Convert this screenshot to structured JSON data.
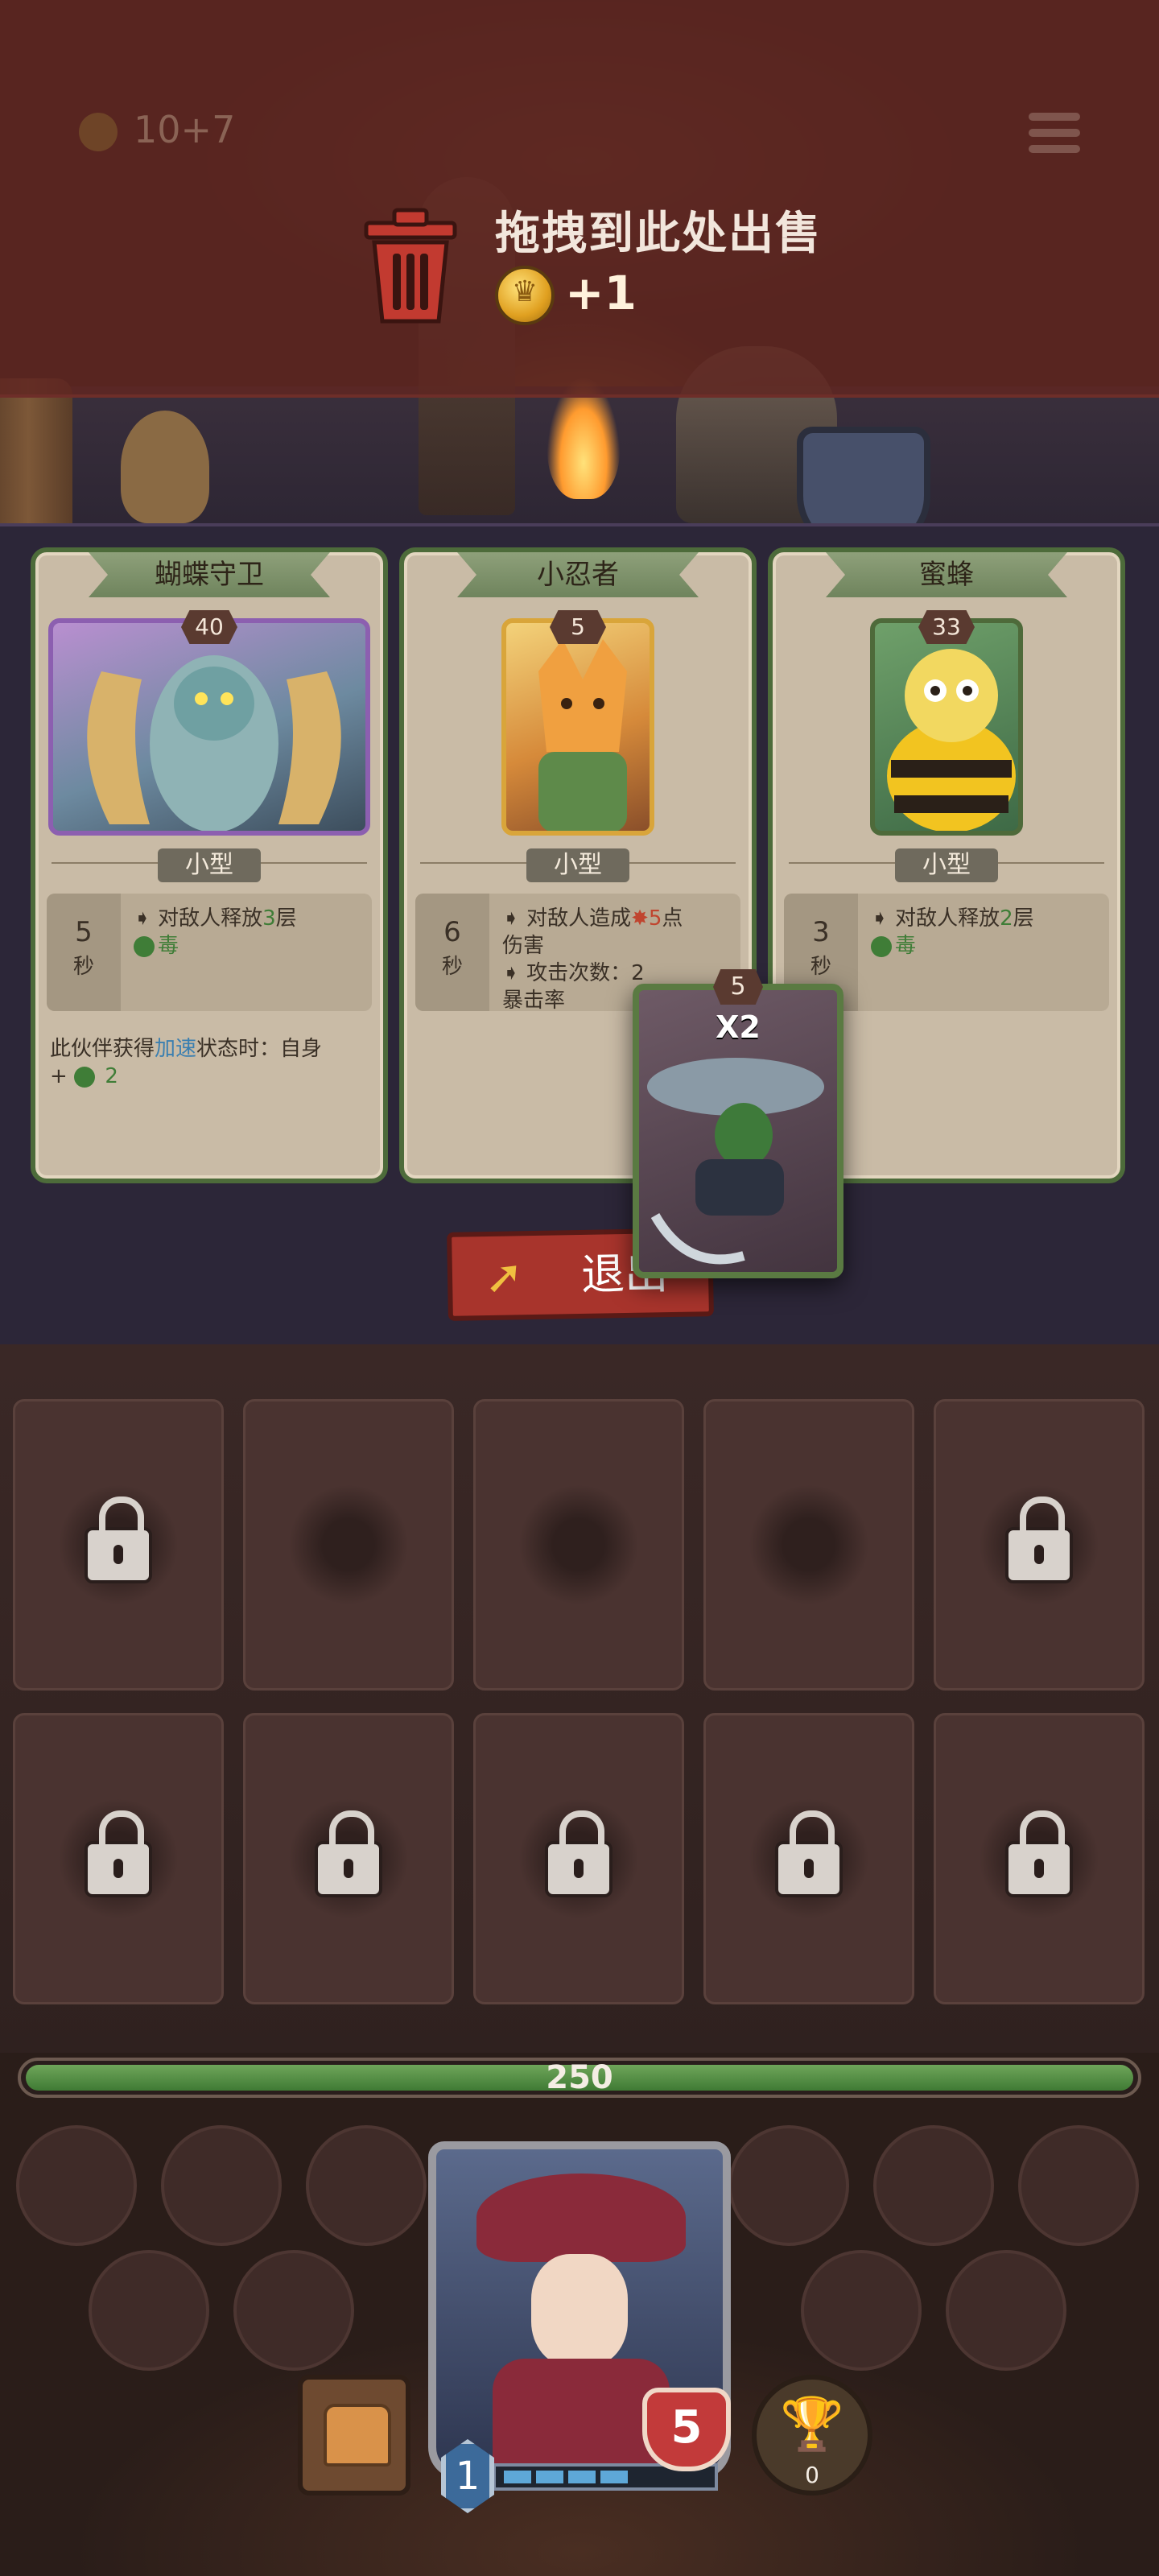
{
  "topbar": {
    "gold_text": "10+7"
  },
  "sell_zone": {
    "title": "拖拽到此处出售",
    "amount": "+1"
  },
  "companions": [
    {
      "name": "蝴蝶守卫",
      "level": "40",
      "size": "小型",
      "cooldown": "5",
      "cooldown_unit": "秒",
      "effect_prefix": "对敌人释放",
      "effect_value": "3",
      "effect_suffix": "层",
      "effect_status": "毒",
      "passive_prefix": "此伙伴获得",
      "passive_keyword": "加速",
      "passive_suffix": "状态时：自身",
      "passive_plus": "+",
      "passive_value": "2"
    },
    {
      "name": "小忍者",
      "level": "5",
      "size": "小型",
      "cooldown": "6",
      "cooldown_unit": "秒",
      "effect_prefix": "对敌人造成",
      "effect_value": "5",
      "effect_suffix": "点",
      "effect_line2": "伤害",
      "effect_line3": "攻击次数：2",
      "effect_line4": "暴击率"
    },
    {
      "name": "蜜蜂",
      "level": "33",
      "size": "小型",
      "cooldown": "3",
      "cooldown_unit": "秒",
      "effect_prefix": "对敌人释放",
      "effect_value": "2",
      "effect_suffix": "层",
      "effect_status": "毒"
    }
  ],
  "dragged_card": {
    "level": "5",
    "multiplier": "X2"
  },
  "exit_button": {
    "label": "退出"
  },
  "inventory": {
    "rows": 2,
    "cols": 5
  },
  "player": {
    "hp": "250",
    "level": "1",
    "heart_value": "5",
    "trophy_count": "0",
    "xp_segments_filled": 4
  },
  "colors": {
    "sell_banner": "#5f2622",
    "card_border": "#4d6b3a",
    "hp_fill": "#3f7a34",
    "exit_button": "#a8342c"
  }
}
